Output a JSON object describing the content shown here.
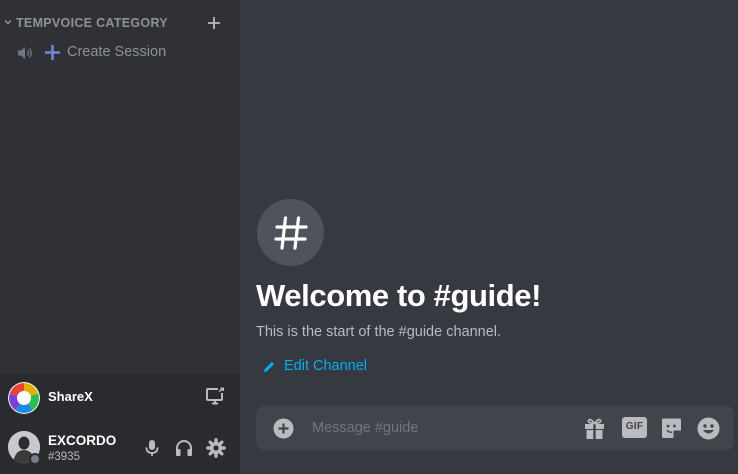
{
  "sidebar": {
    "category": {
      "label": "TEMPVOICE CATEGORY"
    },
    "channels": [
      {
        "label": "Create Session",
        "icon": "speaker-icon"
      }
    ]
  },
  "activity": {
    "app_name": "ShareX",
    "icon": "sharex-logo"
  },
  "user": {
    "name": "EXCORDO",
    "tag": "#3935",
    "status": "offline"
  },
  "main": {
    "channel_icon": "hash-icon",
    "welcome_title": "Welcome to #guide!",
    "start_text": "This is the start of the #guide channel.",
    "edit_channel_label": "Edit Channel",
    "composer": {
      "placeholder": "Message #guide",
      "value": ""
    },
    "gif_label": "GIF"
  },
  "colors": {
    "sidebar_bg": "#2f3136",
    "main_bg": "#36393f",
    "panel_bg": "#292b2f",
    "composer_bg": "#40444b",
    "link": "#00b0f4",
    "accent_purple": "#7289da",
    "muted_text": "#8e9297"
  }
}
